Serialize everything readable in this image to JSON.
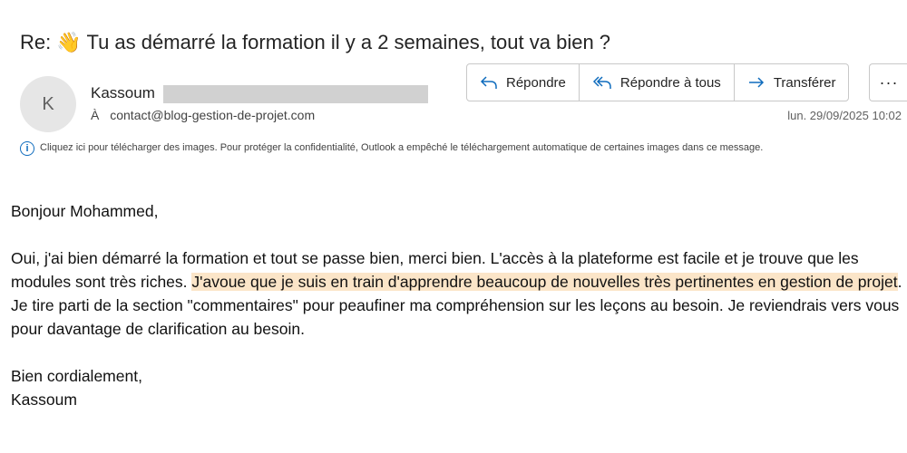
{
  "email": {
    "subject": "Re: 👋 Tu as démarré la formation il y a 2 semaines, tout va bien ?",
    "avatar_initial": "K",
    "sender_name": "Kassoum",
    "to_prefix": "À",
    "to_address": "contact@blog-gestion-de-projet.com",
    "date": "lun. 29/09/2025 10:02"
  },
  "actions": {
    "reply": "Répondre",
    "reply_all": "Répondre à tous",
    "forward": "Transférer",
    "more": "···"
  },
  "info_banner": {
    "text": "Cliquez ici pour télécharger des images. Pour protéger la confidentialité, Outlook a empêché le téléchargement automatique de certaines images dans ce message."
  },
  "body": {
    "greeting": "Bonjour Mohammed,",
    "para1_start": "Oui, j'ai bien démarré la formation et tout se passe bien, merci bien. L'accès à la plateforme est facile et je trouve que les modules sont très riches. ",
    "para1_highlight": "J'avoue que je suis en train d'apprendre beaucoup de nouvelles très pertinentes en gestion de projet",
    "para1_end": ". Je tire parti de la section \"commentaires\" pour peaufiner ma compréhension sur les leçons au besoin. Je reviendrais vers vous pour davantage de clarification au besoin.",
    "closing": "Bien cordialement,",
    "signature": "Kassoum"
  },
  "colors": {
    "accent": "#0f6cbd",
    "highlight": "#fbe5c8"
  }
}
